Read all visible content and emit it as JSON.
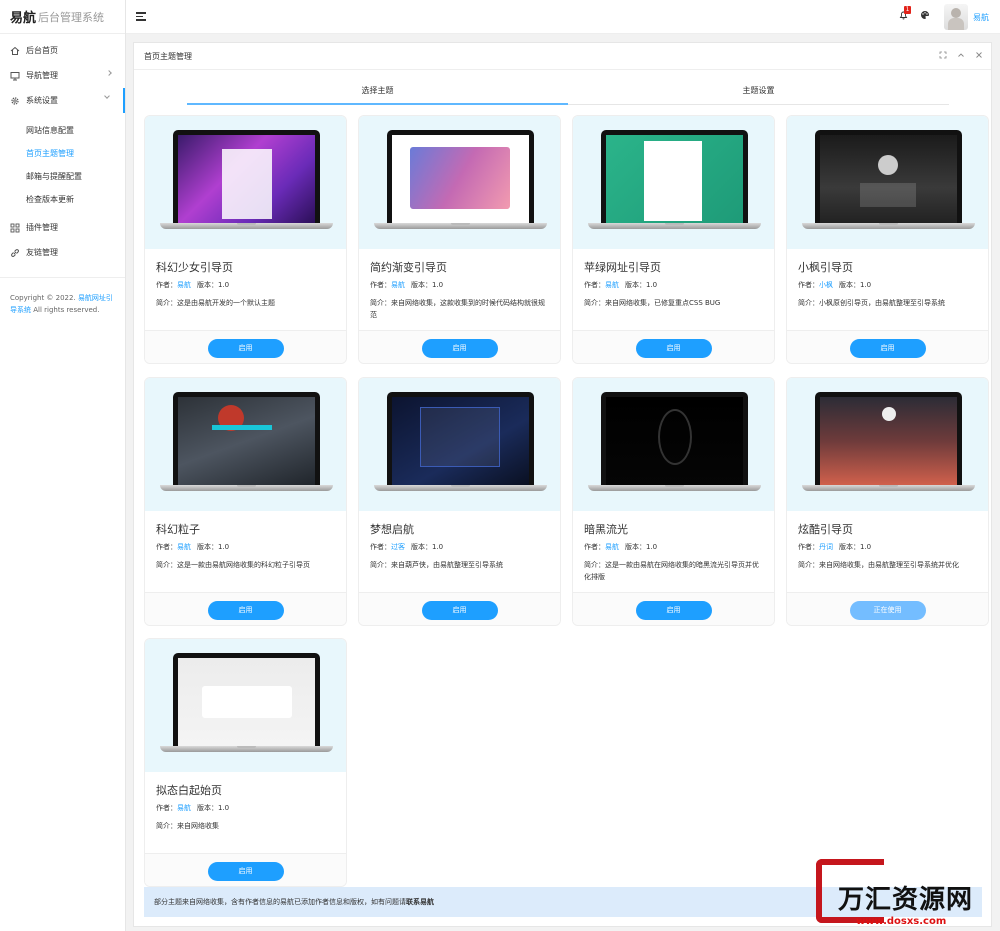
{
  "app": {
    "brand": "易航",
    "subtitle": "后台管理系统"
  },
  "sidebar": {
    "items": [
      {
        "label": "后台首页"
      },
      {
        "label": "导航管理"
      },
      {
        "label": "系统设置"
      }
    ],
    "sub_items": [
      {
        "label": "网站信息配置"
      },
      {
        "label": "首页主题管理"
      },
      {
        "label": "邮箱与提醒配置"
      },
      {
        "label": "检查版本更新"
      }
    ],
    "items2": [
      {
        "label": "插件管理"
      },
      {
        "label": "友链管理"
      }
    ],
    "copyright": {
      "prefix": "Copyright © 2022.",
      "link": "易航网址引导系统",
      "suffix": "All rights reserved."
    }
  },
  "header": {
    "badge": "1",
    "username": "易航"
  },
  "panel": {
    "title": "首页主题管理",
    "tabs": [
      {
        "label": "选择主题"
      },
      {
        "label": "主题设置"
      }
    ],
    "author_label": "作者：",
    "version_label": "版本：",
    "desc_label": "简介：",
    "themes": [
      {
        "title": "科幻少女引导页",
        "author": "易航",
        "version": "1.0",
        "desc": "这是由易航开发的一个默认主题",
        "button": "启用"
      },
      {
        "title": "简约渐变引导页",
        "author": "易航",
        "version": "1.0",
        "desc": "来自网络收集，这款收集到的时候代码结构就很规范",
        "button": "启用"
      },
      {
        "title": "苹绿网址引导页",
        "author": "易航",
        "version": "1.0",
        "desc": "来自网络收集，已修复重点CSS BUG",
        "button": "启用"
      },
      {
        "title": "小枫引导页",
        "author": "小枫",
        "version": "1.0",
        "desc": "小枫原创引导页，由易航整理至引导系统",
        "button": "启用"
      },
      {
        "title": "科幻粒子",
        "author": "易航",
        "version": "1.0",
        "desc": "这是一款由易航网络收集的科幻粒子引导页",
        "button": "启用"
      },
      {
        "title": "梦想启航",
        "author": "过客",
        "version": "1.0",
        "desc": "来自葫芦侠，由易航整理至引导系统",
        "button": "启用"
      },
      {
        "title": "暗黑流光",
        "author": "易航",
        "version": "1.0",
        "desc": "这是一款由易航在网络收集的暗黑流光引导页并优化排版",
        "button": "启用"
      },
      {
        "title": "炫酷引导页",
        "author": "丹词",
        "version": "1.0",
        "desc": "来自网络收集，由易航整理至引导系统并优化",
        "button": "正在使用"
      },
      {
        "title": "拟态白起始页",
        "author": "易航",
        "version": "1.0",
        "desc": "来自网络收集",
        "button": "启用"
      }
    ],
    "notice": {
      "text": "部分主题来自网络收集，含有作者信息的易航已添加作者信息和版权，如有问题请",
      "bold": "联系易航"
    }
  },
  "watermark": {
    "text": "万汇资源网",
    "url": "www.dosxs.com"
  },
  "colors": {
    "accent": "#1E9FFF",
    "active_button": "#74BDFF",
    "thumb_bg": "#e8f7fc",
    "notice_bg": "#dcebfb"
  },
  "icons": {
    "home": "home-icon",
    "nav": "monitor-icon",
    "settings": "gear-icon",
    "plugin": "grid-icon",
    "link": "link-icon",
    "bell": "bell-icon",
    "theme": "palette-icon"
  }
}
